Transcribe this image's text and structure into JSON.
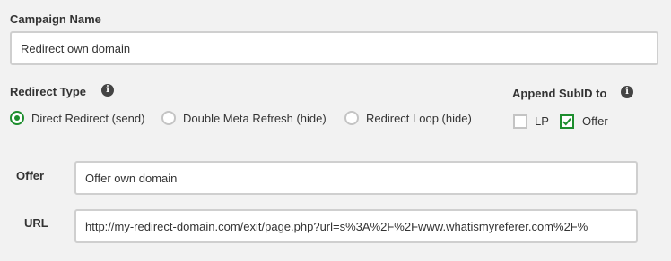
{
  "campaign": {
    "label": "Campaign Name",
    "value": "Redirect own domain"
  },
  "redirect_type": {
    "label": "Redirect Type",
    "options": [
      {
        "label": "Direct Redirect (send)",
        "selected": true
      },
      {
        "label": "Double Meta Refresh (hide)",
        "selected": false
      },
      {
        "label": "Redirect Loop (hide)",
        "selected": false
      }
    ]
  },
  "append_subid": {
    "label": "Append SubID to",
    "options": [
      {
        "label": "LP",
        "checked": false
      },
      {
        "label": "Offer",
        "checked": true
      }
    ]
  },
  "offer": {
    "label": "Offer",
    "value": "Offer own domain"
  },
  "url": {
    "label": "URL",
    "value": "http://my-redirect-domain.com/exit/page.php?url=s%3A%2F%2Fwww.whatismyreferer.com%2F%"
  },
  "icons": {
    "info": "info-icon",
    "radio": "radio-button",
    "checkmark": "checkmark-icon"
  },
  "colors": {
    "accent": "#1e8e2e",
    "background": "#f2f2f2",
    "border": "#cfcfcf"
  }
}
